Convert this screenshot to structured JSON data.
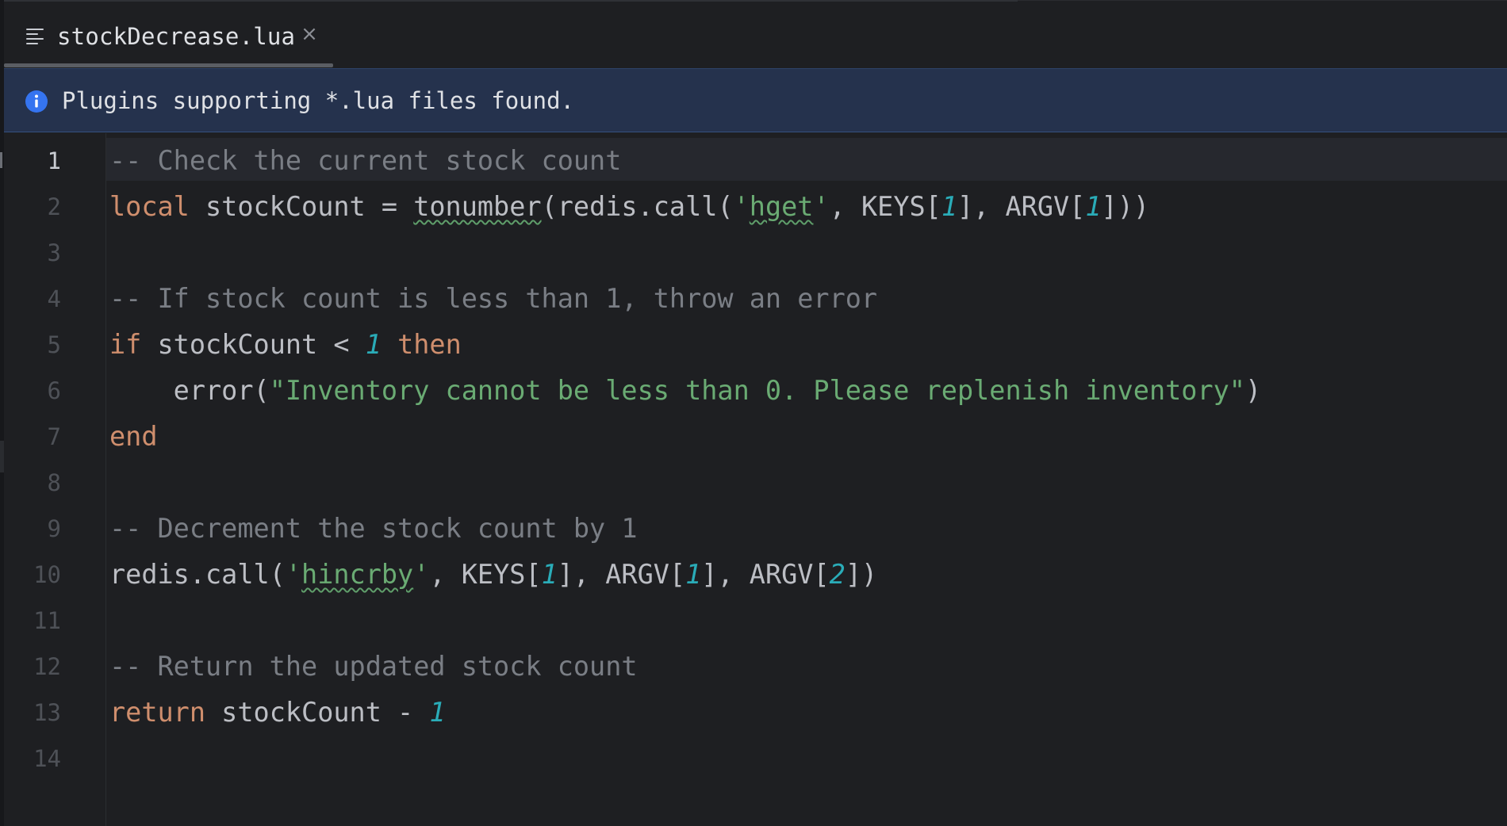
{
  "tab": {
    "filename": "stockDecrease.lua",
    "close_glyph": "×",
    "icon": "file-lines-icon"
  },
  "banner": {
    "icon": "info-icon",
    "message": "Plugins supporting *.lua files found."
  },
  "editor": {
    "active_line": 1,
    "line_numbers": [
      "1",
      "2",
      "3",
      "4",
      "5",
      "6",
      "7",
      "8",
      "9",
      "10",
      "11",
      "12",
      "13",
      "14"
    ],
    "lines": {
      "l1": {
        "comment": "-- Check the current stock count"
      },
      "l2": {
        "kw_local": "local",
        "text_a": " stockCount = ",
        "fn_tonumber": "tonumber",
        "text_b": "(redis.call(",
        "str_q1": "'",
        "str_hget": "hget",
        "str_q2": "'",
        "text_c": ", KEYS[",
        "num_a": "1",
        "text_d": "], ARGV[",
        "num_b": "1",
        "text_e": "]))"
      },
      "l3": {},
      "l4": {
        "comment": "-- If stock count is less than 1, throw an error"
      },
      "l5": {
        "kw_if": "if",
        "text_a": " stockCount < ",
        "num_a": "1",
        "text_b": " ",
        "kw_then": "then"
      },
      "l6": {
        "text_a": "    error(",
        "str": "\"Inventory cannot be less than 0. Please replenish inventory\"",
        "text_b": ")"
      },
      "l7": {
        "kw_end": "end"
      },
      "l8": {},
      "l9": {
        "comment": "-- Decrement the stock count by 1"
      },
      "l10": {
        "text_a": "redis.call(",
        "str_q1": "'",
        "str_hincrby": "hincrby",
        "str_q2": "'",
        "text_b": ", KEYS[",
        "num_a": "1",
        "text_c": "], ARGV[",
        "num_b": "1",
        "text_d": "], ARGV[",
        "num_c": "2",
        "text_e": "])"
      },
      "l11": {},
      "l12": {
        "comment": "-- Return the updated stock count"
      },
      "l13": {
        "kw_return": "return",
        "text_a": " stockCount - ",
        "num_a": "1"
      },
      "l14": {}
    }
  },
  "colors": {
    "background": "#1e1f22",
    "banner_background": "#25324d",
    "keyword": "#cf8e6d",
    "comment": "#7a7e85",
    "string": "#6aab73",
    "number": "#2aacb8",
    "text": "#bcbec4",
    "info_accent": "#3574f0"
  }
}
